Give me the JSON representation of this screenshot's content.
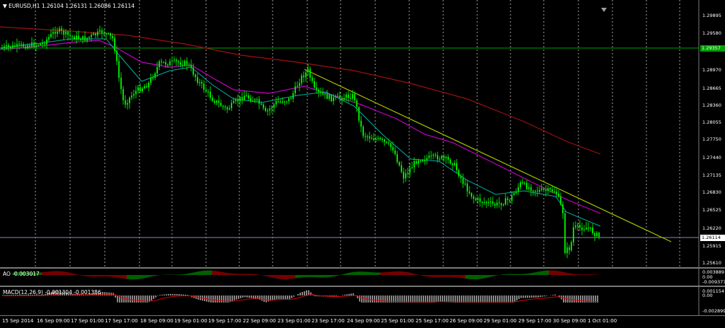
{
  "main": {
    "title": "EURUSD,H1",
    "ohlc": "1.26104 1.26131 1.26086 1.26114",
    "dropdown_glyph": "▼",
    "y_labels": [
      "1.29895",
      "1.29580",
      "1.29275",
      "1.28970",
      "1.28665",
      "1.28360",
      "1.28055",
      "1.27750",
      "1.27440",
      "1.27135",
      "1.26830",
      "1.26525",
      "1.26220",
      "1.25915",
      "1.25610"
    ],
    "green_line_price": "1.29357",
    "current_price": "1.26114",
    "colors": {
      "candle": "#00e000",
      "sma_fast": "#00b0a0",
      "sma_mid": "#c800c8",
      "sma_slow": "#a01010",
      "trendline": "#a8c800",
      "hline_green": "#00a000",
      "hline_blue": "#8090b0",
      "grid": "#ffffff"
    }
  },
  "ao": {
    "title": "AO -0.003017",
    "y_labels": [
      "0.003889",
      "0.00",
      "-0.009377"
    ]
  },
  "macd": {
    "title": "MACD(12,26,9) -0.001304 -0.001386",
    "y_labels": [
      "0.001154",
      "0.00",
      "-0.002899"
    ]
  },
  "x_labels": [
    "15 Sep 2014",
    "16 Sep 09:00",
    "17 Sep 01:00",
    "17 Sep 17:00",
    "18 Sep 09:00",
    "19 Sep 01:00",
    "19 Sep 17:00",
    "22 Sep 09:00",
    "23 Sep 01:00",
    "23 Sep 17:00",
    "24 Sep 09:00",
    "25 Sep 01:00",
    "25 Sep 17:00",
    "26 Sep 09:00",
    "29 Sep 01:00",
    "29 Sep 17:00",
    "30 Sep 09:00",
    "1 Oct 01:00"
  ]
}
